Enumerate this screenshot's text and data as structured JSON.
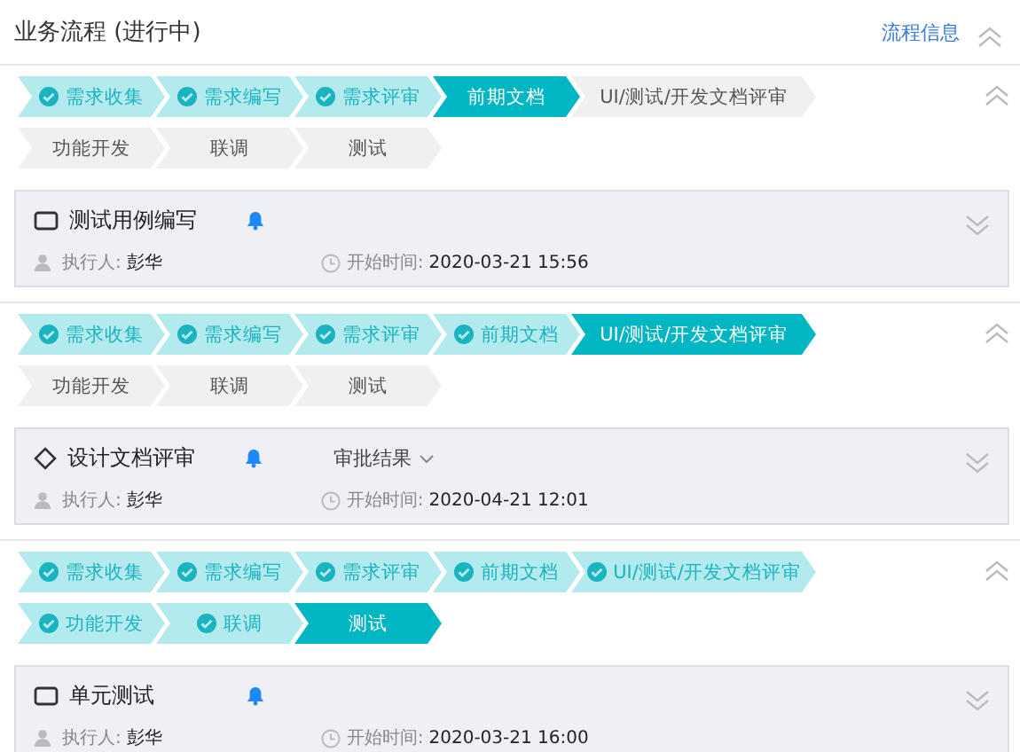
{
  "header": {
    "title": "业务流程 (进行中)",
    "link": "流程信息"
  },
  "sections": [
    {
      "rows": [
        [
          {
            "label": "需求收集",
            "done": true,
            "current": false
          },
          {
            "label": "需求编写",
            "done": true,
            "current": false
          },
          {
            "label": "需求评审",
            "done": true,
            "current": false
          },
          {
            "label": "前期文档",
            "done": false,
            "current": true
          },
          {
            "label": "UI/测试/开发文档评审",
            "done": false,
            "current": false
          }
        ],
        [
          {
            "label": "功能开发",
            "done": false,
            "current": false
          },
          {
            "label": "联调",
            "done": false,
            "current": false
          },
          {
            "label": "测试",
            "done": false,
            "current": false
          }
        ]
      ],
      "task": {
        "kind": "task",
        "title": "测试用例编写",
        "executor_label": "执行人:",
        "executor": "彭华",
        "start_label": "开始时间:",
        "start_time": "2020-03-21 15:56"
      }
    },
    {
      "rows": [
        [
          {
            "label": "需求收集",
            "done": true,
            "current": false
          },
          {
            "label": "需求编写",
            "done": true,
            "current": false
          },
          {
            "label": "需求评审",
            "done": true,
            "current": false
          },
          {
            "label": "前期文档",
            "done": true,
            "current": false
          },
          {
            "label": "UI/测试/开发文档评审",
            "done": false,
            "current": true
          }
        ],
        [
          {
            "label": "功能开发",
            "done": false,
            "current": false
          },
          {
            "label": "联调",
            "done": false,
            "current": false
          },
          {
            "label": "测试",
            "done": false,
            "current": false
          }
        ]
      ],
      "task": {
        "kind": "approval",
        "title": "设计文档评审",
        "approval": "审批结果",
        "executor_label": "执行人:",
        "executor": "彭华",
        "start_label": "开始时间:",
        "start_time": "2020-04-21 12:01"
      }
    },
    {
      "rows": [
        [
          {
            "label": "需求收集",
            "done": true,
            "current": false
          },
          {
            "label": "需求编写",
            "done": true,
            "current": false
          },
          {
            "label": "需求评审",
            "done": true,
            "current": false
          },
          {
            "label": "前期文档",
            "done": true,
            "current": false
          },
          {
            "label": "UI/测试/开发文档评审",
            "done": true,
            "current": false
          }
        ],
        [
          {
            "label": "功能开发",
            "done": true,
            "current": false
          },
          {
            "label": "联调",
            "done": true,
            "current": false
          },
          {
            "label": "测试",
            "done": false,
            "current": true
          }
        ]
      ],
      "task": {
        "kind": "task",
        "title": "单元测试",
        "executor_label": "执行人:",
        "executor": "彭华",
        "start_label": "开始时间:",
        "start_time": "2020-03-21 16:00"
      }
    }
  ]
}
